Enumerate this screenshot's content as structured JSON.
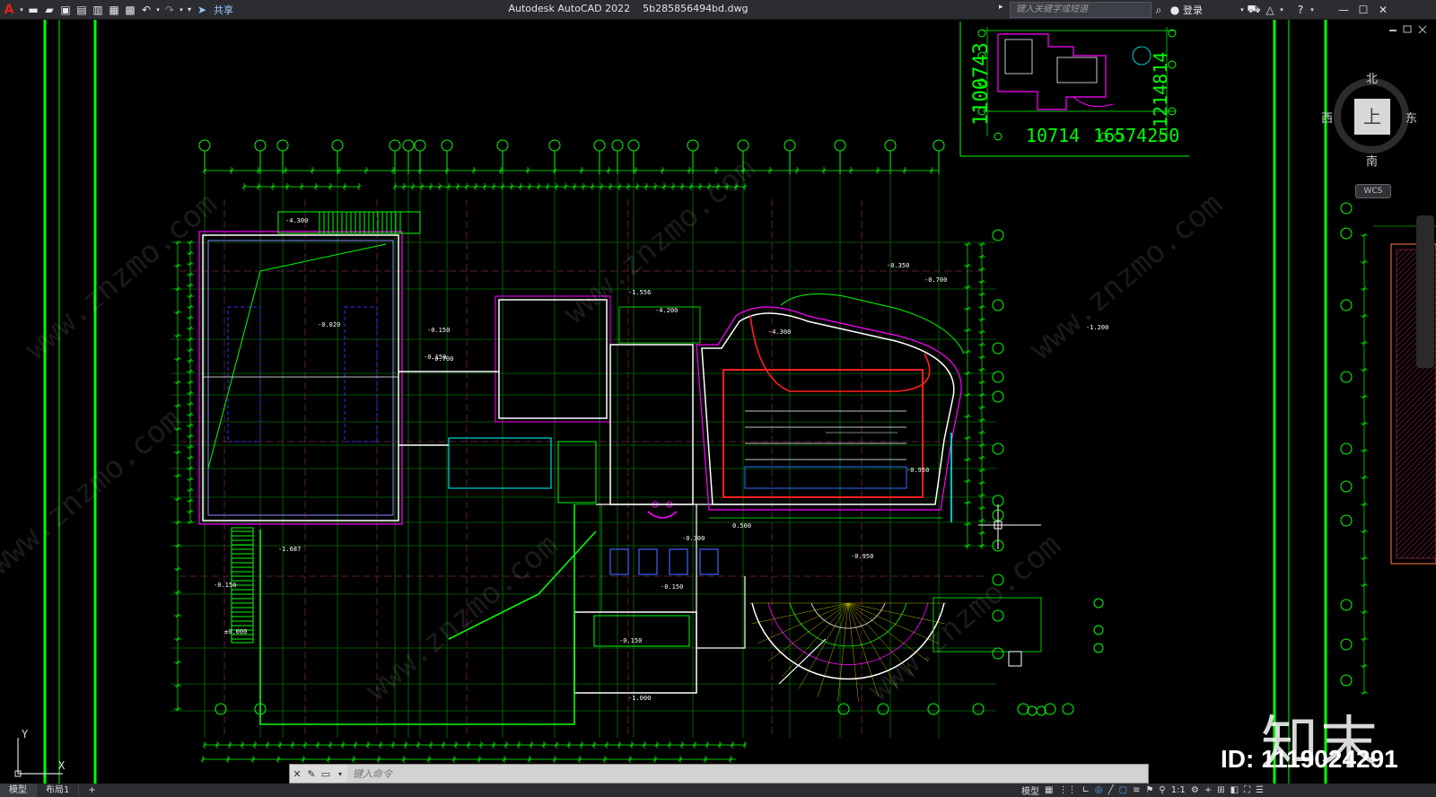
{
  "titlebar": {
    "app_title": "Autodesk AutoCAD 2022",
    "file_name": "5b285856494bd.dwg",
    "share_label": "共享",
    "search_placeholder": "键入关键字或短语",
    "login_label": "登录"
  },
  "viewcube": {
    "north": "北",
    "south": "南",
    "east": "东",
    "west": "西",
    "face": "上",
    "wcs_label": "WCS"
  },
  "drawing": {
    "inset_dims": [
      "1100743",
      "10714",
      "16574250",
      "1214814"
    ],
    "elev_labels": [
      "-4.300",
      "-0.150",
      "-1.556",
      "-4.200",
      "-0.020",
      "-0.150",
      "-0.700",
      "-0.350",
      "-0.700",
      "-1.200",
      "-4.300",
      "-1.687",
      "-0.150",
      "±0.000",
      "-0.150",
      "-0.300",
      "0.500",
      "-0.150",
      "-1.000",
      "-0.950",
      "-0.950"
    ],
    "colors": {
      "axis": "#00ff00",
      "wall": "#ffffff",
      "dim": "#00ff00",
      "accent": "#ff00ff",
      "red": "#ff2020",
      "yellow": "#ffff00",
      "blue": "#4040ff",
      "cyan": "#00ffff"
    }
  },
  "ucs": {
    "x": "X",
    "y": "Y"
  },
  "command": {
    "placeholder": "键入命令"
  },
  "statusbar": {
    "tab_model": "模型",
    "tab_layout": "布局1",
    "add_tab": "+",
    "right_model": "模型",
    "scale": "1:1"
  },
  "watermark": {
    "brand": "知末",
    "id_text": "ID: 1119024291",
    "site": "www.znzmo.com"
  }
}
